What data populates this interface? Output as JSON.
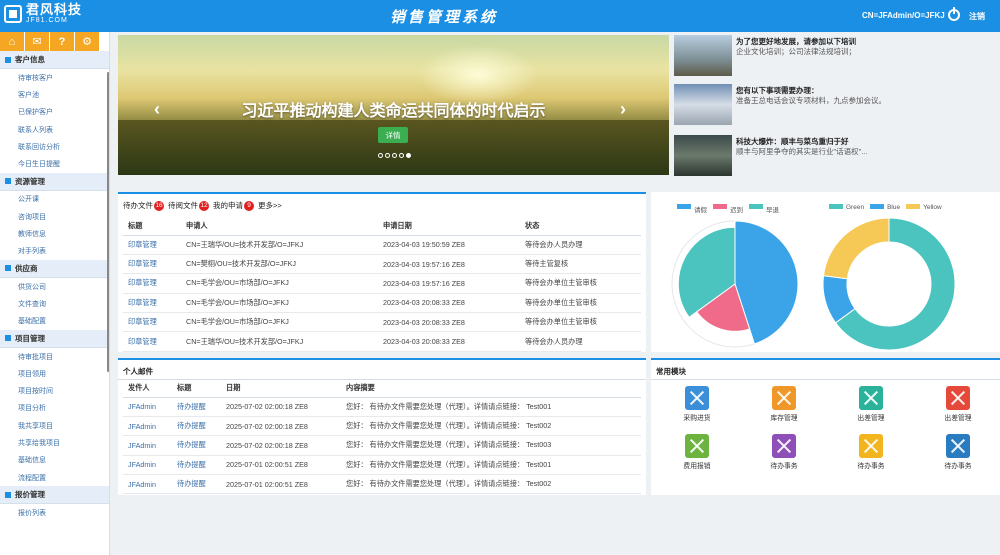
{
  "header": {
    "logo_name": "君风科技",
    "logo_domain": "JF81.COM",
    "title": "销售管理系统",
    "user": "CN=JFAdmin/O=JFKJ",
    "logout": "注销"
  },
  "sidebar": {
    "quick_icons": [
      "home-icon",
      "mail-icon",
      "help-icon",
      "gear-icon"
    ],
    "sections": [
      {
        "title": "客户信息",
        "items": [
          "待审核客户",
          "客户池",
          "已保护客户",
          "联系人列表",
          "联系回访分析",
          "今日生日提醒"
        ]
      },
      {
        "title": "资源管理",
        "items": [
          "公开课",
          "咨询项目",
          "教师信息",
          "对手列表"
        ]
      },
      {
        "title": "供应商",
        "items": [
          "供货公司",
          "文件查询",
          "基础配置"
        ]
      },
      {
        "title": "项目管理",
        "items": [
          "待审批项目",
          "项目领用",
          "项目按时间",
          "项目分析",
          "我共享项目",
          "共享给我项目",
          "基础信息",
          "流程配置"
        ]
      },
      {
        "title": "报价管理",
        "items": [
          "报价列表"
        ]
      }
    ]
  },
  "carousel": {
    "title": "习近平推动构建人类命运共同体的时代启示",
    "button": "详情",
    "prev": "‹",
    "next": "›"
  },
  "news": [
    {
      "title": "为了您更好地发展，请参加以下培训",
      "desc": "企业文化培训；公司法律法规培训；"
    },
    {
      "title": "您有以下事项需要办理：",
      "desc": "准备王总电话会议专项材料，九点参加会议。"
    },
    {
      "title": "科技大爆炸：顺丰与菜鸟重归于好",
      "desc": "顺丰与阿里争夺的其实是行业\"话语权\"..."
    }
  ],
  "docs": {
    "tabs": [
      {
        "label": "待办文件",
        "count": "16"
      },
      {
        "label": "待阅文件",
        "count": "12"
      },
      {
        "label": "我的申请",
        "count": "9"
      }
    ],
    "more": "更多>>",
    "headers": [
      "标题",
      "申请人",
      "申请日期",
      "状态"
    ],
    "rows": [
      [
        "印章管理",
        "CN=王瑞华/OU=技术开发部/O=JFKJ",
        "2023-04-03 19:50:59 ZE8",
        "等待会办人员办理"
      ],
      [
        "印章管理",
        "CN=樊栩/OU=技术开发部/O=JFKJ",
        "2023-04-03 19:57:16 ZE8",
        "等待主管复核"
      ],
      [
        "印章管理",
        "CN=毛学会/OU=市场部/O=JFKJ",
        "2023-04-03 19:57:16 ZE8",
        "等待会办单位主管审核"
      ],
      [
        "印章管理",
        "CN=毛学会/OU=市场部/O=JFKJ",
        "2023-04-03 20:08:33 ZE8",
        "等待会办单位主管审核"
      ],
      [
        "印章管理",
        "CN=毛学会/OU=市场部/O=JFKJ",
        "2023-04-03 20:08:33 ZE8",
        "等待会办单位主管审核"
      ],
      [
        "印章管理",
        "CN=王瑞华/OU=技术开发部/O=JFKJ",
        "2023-04-03 20:08:33 ZE8",
        "等待会办人员办理"
      ]
    ]
  },
  "charts": {
    "chart_data": [
      {
        "type": "pie",
        "legend": [
          "请假",
          "迟到",
          "早退"
        ],
        "colors": [
          "#3ba4e8",
          "#f06a8a",
          "#4bc4c0"
        ],
        "values": [
          45,
          20,
          35
        ]
      },
      {
        "type": "pie",
        "legend": [
          "Green",
          "Blue",
          "Yellow"
        ],
        "colors": [
          "#4bc4c0",
          "#3ba4e8",
          "#f6c957"
        ],
        "values": [
          65,
          12,
          23
        ]
      }
    ]
  },
  "mail": {
    "title": "个人邮件",
    "headers": [
      "发件人",
      "标题",
      "日期",
      "内容摘要"
    ],
    "rows": [
      [
        "JFAdmin",
        "待办提醒",
        "2025-07-02 02:00:18 ZE8",
        "您好：    有待办文件需要您处理（代理）。详情请点链接：  Test001"
      ],
      [
        "JFAdmin",
        "待办提醒",
        "2025-07-02 02:00:18 ZE8",
        "您好：    有待办文件需要您处理（代理）。详情请点链接：  Test002"
      ],
      [
        "JFAdmin",
        "待办提醒",
        "2025-07-02 02:00:18 ZE8",
        "您好：    有待办文件需要您处理（代理）。详情请点链接：  Test003"
      ],
      [
        "JFAdmin",
        "待办提醒",
        "2025-07-01 02:00:51 ZE8",
        "您好：    有待办文件需要您处理（代理）。详情请点链接：  Test001"
      ],
      [
        "JFAdmin",
        "待办提醒",
        "2025-07-01 02:00:51 ZE8",
        "您好：    有待办文件需要您处理（代理）。详情请点链接：  Test002"
      ]
    ]
  },
  "modules": {
    "title": "常用模块",
    "items": [
      {
        "label": "采购进货",
        "color": "#3b8fd9"
      },
      {
        "label": "库存管理",
        "color": "#f0972a"
      },
      {
        "label": "出差管理",
        "color": "#2ab29a"
      },
      {
        "label": "出差管理",
        "color": "#e5493a"
      },
      {
        "label": "费用报销",
        "color": "#6cb33f"
      },
      {
        "label": "待办事务",
        "color": "#8e4fb8"
      },
      {
        "label": "待办事务",
        "color": "#f2b51e"
      },
      {
        "label": "待办事务",
        "color": "#2a7cc1"
      }
    ]
  }
}
